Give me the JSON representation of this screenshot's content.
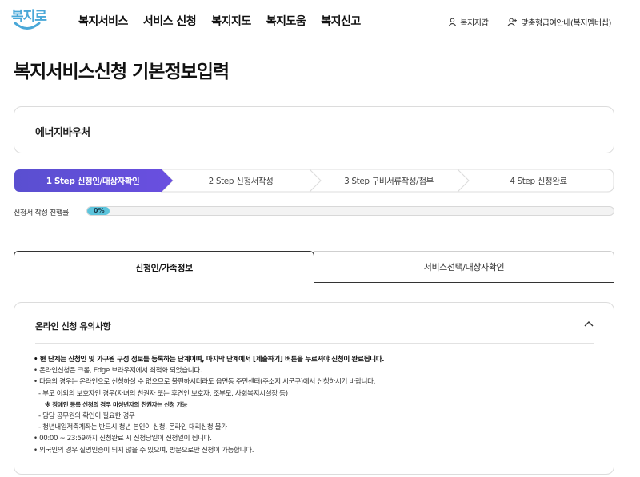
{
  "header": {
    "logo_text": "복지로",
    "nav": [
      "복지서비스",
      "서비스 신청",
      "복지지도",
      "복지도움",
      "복지신고"
    ],
    "util": {
      "wallet_label": "복지지갑",
      "custom_label": "맞춤형급여안내(복지멤버십)"
    }
  },
  "page_title": "복지서비스신청 기본정보입력",
  "voucher": {
    "name": "에너지바우처"
  },
  "steps": [
    {
      "label": "1 Step 신청인/대상자확인",
      "active": true
    },
    {
      "label": "2 Step 신청서작성",
      "active": false
    },
    {
      "label": "3 Step 구비서류작성/첨부",
      "active": false
    },
    {
      "label": "4 Step 신청완료",
      "active": false
    }
  ],
  "progress": {
    "label": "신청서 작성 진행률",
    "value_text": "0%",
    "value": 0
  },
  "tabs": [
    {
      "label": "신청인/가족정보",
      "selected": true
    },
    {
      "label": "서비스선택/대상자확인",
      "selected": false
    }
  ],
  "notice": {
    "title": "온라인 신청 유의사항",
    "lines": [
      {
        "text": "현 단계는 신청인 및 가구원 구성 정보를 등록하는 단계이며, 마지막 단계에서 [제출하기] 버튼을 누르셔야 신청이 완료됩니다.",
        "type": "bullet-strong"
      },
      {
        "text": "온라인신청은 크롬, Edge 브라우저에서 최적화 되었습니다.",
        "type": "bullet"
      },
      {
        "text": "다음의 경우는 온라인으로 신청하실 수 없으므로 불편하시더라도 읍면동 주민센터(주소지 시군구)에서 신청하시기 바랍니다.",
        "type": "bullet"
      },
      {
        "text": "- 부모 이외의 보호자인 경우(자녀의 친권자 또는 후견인 보호자, 조부모, 사회복지시설장 등)",
        "type": "sub"
      },
      {
        "text": "※ 장애인 등록 신청의 경우 미성년자의 친권자는 신청 가능",
        "type": "note"
      },
      {
        "text": "- 담당 공무원의 확인이 필요한 경우",
        "type": "sub"
      },
      {
        "text": "- 청년내일저축계좌는 반드시 청년 본인이 신청, 온라인 대리신청 불가",
        "type": "sub"
      },
      {
        "text": "00:00 ~ 23:59까지 신청완료 시 신청당일이 신청일이 됩니다.",
        "type": "bullet"
      },
      {
        "text": "외국인의 경우 실명인증이 되지 않을 수 있으며, 방문으로만 신청이 가능합니다.",
        "type": "bullet"
      }
    ]
  },
  "colors": {
    "step_active_start": "#5a4fd0",
    "step_active_end": "#6a4fe0",
    "progress_fill": "#5cc4dc",
    "logo": "#4aa8d8"
  },
  "icons": {
    "wallet": "person-icon",
    "custom": "person-add-icon",
    "collapse": "chevron-up-icon"
  }
}
